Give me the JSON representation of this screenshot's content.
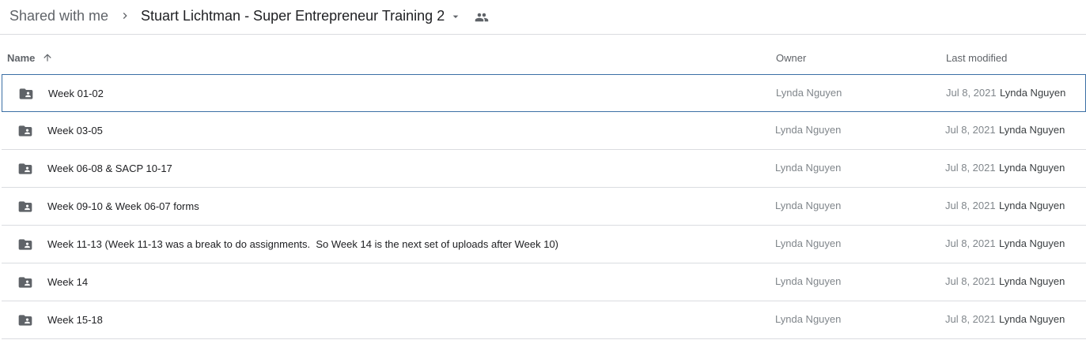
{
  "breadcrumb": {
    "root_label": "Shared with me",
    "current_label": "Stuart Lichtman - Super Entrepreneur Training 2"
  },
  "columns": {
    "name": "Name",
    "owner": "Owner",
    "last_modified": "Last modified"
  },
  "rows": [
    {
      "name": "Week 01-02",
      "owner": "Lynda Nguyen",
      "modified_date": "Jul 8, 2021",
      "modified_by": "Lynda Nguyen",
      "selected": true
    },
    {
      "name": "Week 03-05",
      "owner": "Lynda Nguyen",
      "modified_date": "Jul 8, 2021",
      "modified_by": "Lynda Nguyen"
    },
    {
      "name": "Week 06-08 & SACP 10-17",
      "owner": "Lynda Nguyen",
      "modified_date": "Jul 8, 2021",
      "modified_by": "Lynda Nguyen"
    },
    {
      "name": "Week 09-10 & Week 06-07 forms",
      "owner": "Lynda Nguyen",
      "modified_date": "Jul 8, 2021",
      "modified_by": "Lynda Nguyen"
    },
    {
      "name": "Week 11-13 (Week 11-13 was a break to do assignments.  So Week 14 is the next set of uploads after Week 10)",
      "owner": "Lynda Nguyen",
      "modified_date": "Jul 8, 2021",
      "modified_by": "Lynda Nguyen"
    },
    {
      "name": "Week 14",
      "owner": "Lynda Nguyen",
      "modified_date": "Jul 8, 2021",
      "modified_by": "Lynda Nguyen"
    },
    {
      "name": "Week 15-18",
      "owner": "Lynda Nguyen",
      "modified_date": "Jul 8, 2021",
      "modified_by": "Lynda Nguyen"
    }
  ],
  "icons": {
    "breadcrumb_separator": "chevron-right-icon",
    "dropdown": "arrow-drop-down-icon",
    "shared": "people-icon",
    "sort": "arrow-up-icon",
    "folder": "shared-folder-icon"
  },
  "colors": {
    "selected_border": "#3b6fa5",
    "divider": "#dadce0",
    "icon": "#5f6368"
  }
}
